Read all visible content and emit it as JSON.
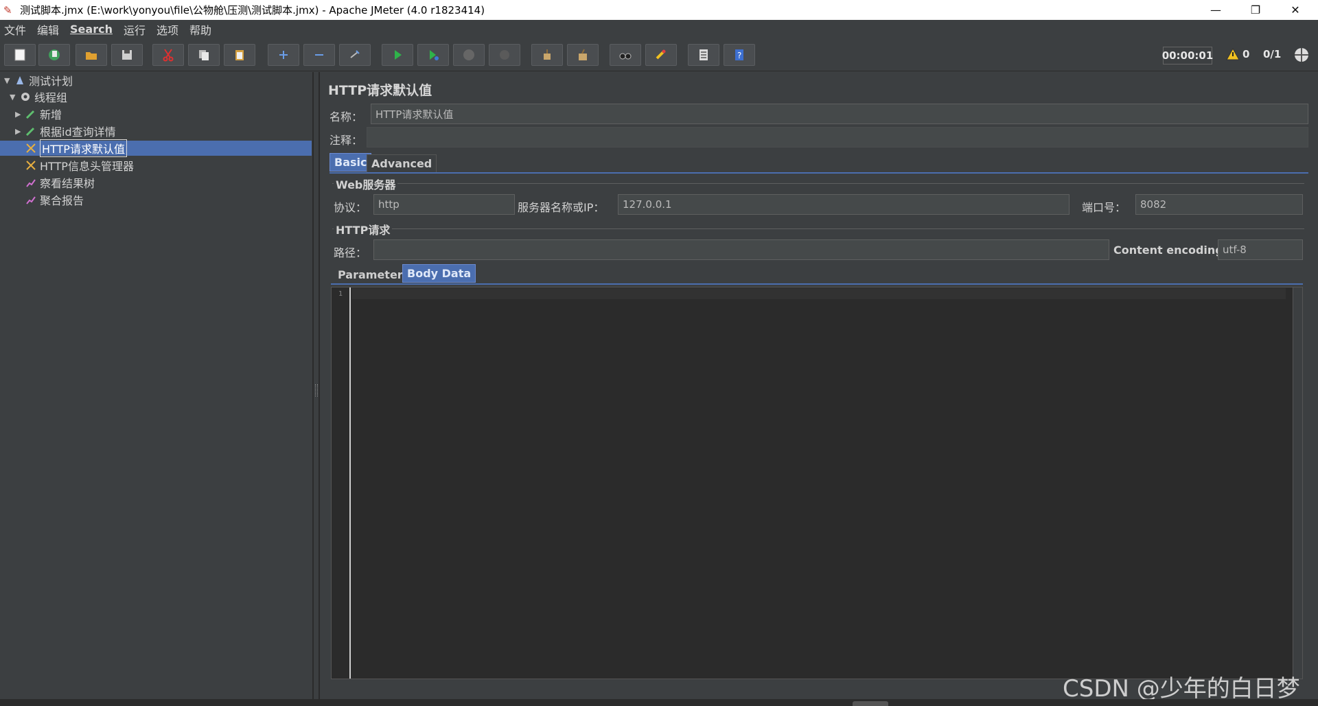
{
  "window": {
    "title": "测试脚本.jmx (E:\\work\\yonyou\\file\\公物舱\\压测\\测试脚本.jmx) - Apache JMeter (4.0 r1823414)",
    "minimize": "—",
    "restore": "❐",
    "close": "✕"
  },
  "menu": {
    "items": [
      "文件",
      "编辑",
      "Search",
      "运行",
      "选项",
      "帮助"
    ]
  },
  "toolbar": {
    "timer": "00:00:01",
    "warnings": "0",
    "threads": "0/1"
  },
  "tree": {
    "items": [
      "测试计划",
      "线程组",
      "新增",
      "根据id查询详情",
      "HTTP请求默认值",
      "HTTP信息头管理器",
      "察看结果树",
      "聚合报告"
    ]
  },
  "panel": {
    "title": "HTTP请求默认值",
    "name_label": "名称：",
    "name_value": "HTTP请求默认值",
    "comment_label": "注释：",
    "comment_value": "",
    "tabs": [
      "Basic",
      "Advanced"
    ],
    "web_server_group": "Web服务器",
    "protocol_label": "协议：",
    "protocol_value": "http",
    "server_label": "服务器名称或IP：",
    "server_value": "127.0.0.1",
    "port_label": "端口号：",
    "port_value": "8082",
    "http_request_group": "HTTP请求",
    "path_label": "路径：",
    "path_value": "",
    "encoding_label": "Content encoding:",
    "encoding_value": "utf-8",
    "subtabs": [
      "Parameters",
      "Body Data"
    ],
    "editor_line": "1"
  },
  "watermark": "CSDN @少年的白日梦",
  "colors": {
    "background": "#3c3f41",
    "selection": "#4b6eaf",
    "editor": "#2b2b2b"
  }
}
